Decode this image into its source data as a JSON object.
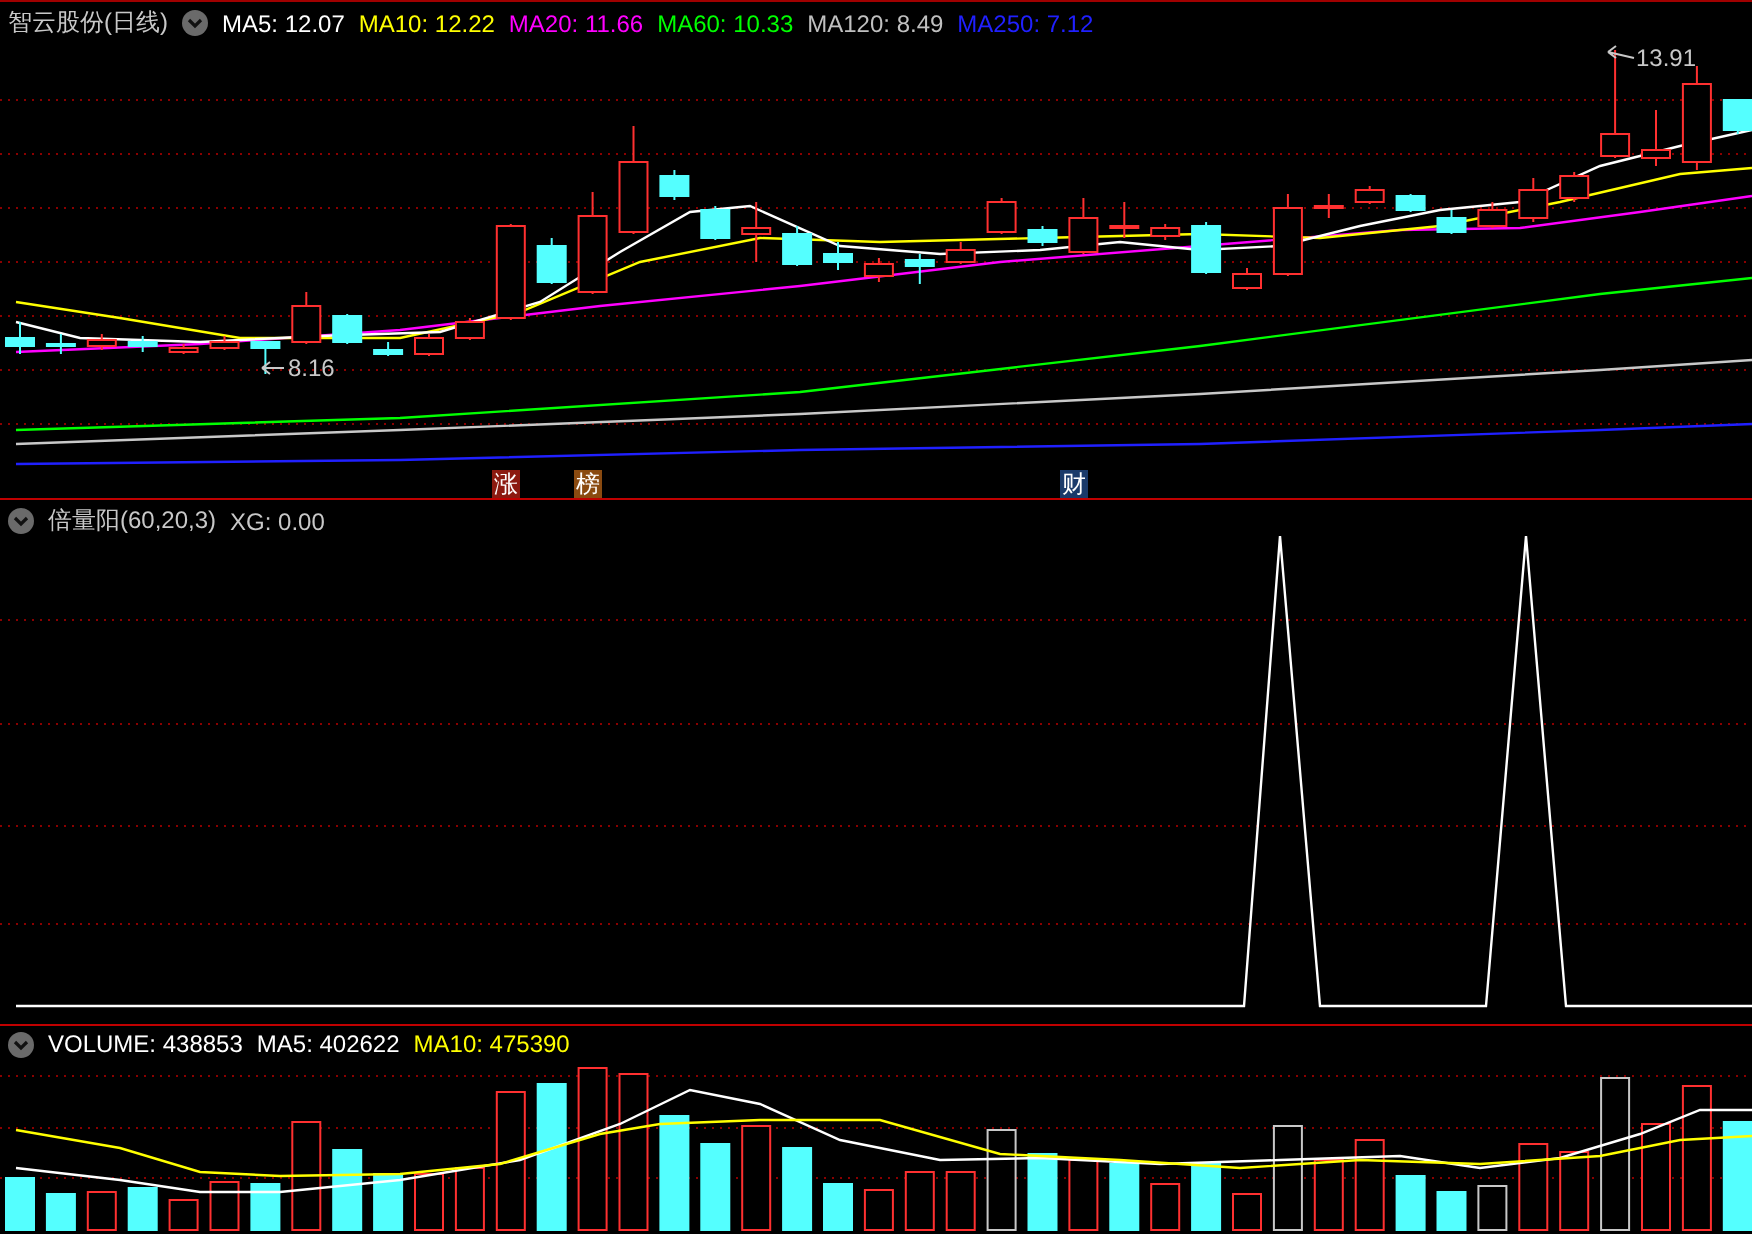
{
  "main_panel": {
    "title": "智云股份(日线)",
    "legend": [
      {
        "text": "MA5: 12.07",
        "color": "#ffffff"
      },
      {
        "text": "MA10: 12.22",
        "color": "#ffff00"
      },
      {
        "text": "MA20: 11.66",
        "color": "#ff00ff"
      },
      {
        "text": "MA60: 10.33",
        "color": "#00ff00"
      },
      {
        "text": "MA120: 8.49",
        "color": "#c0c0c0"
      },
      {
        "text": "MA250: 7.12",
        "color": "#2020ff"
      }
    ],
    "high_label": "13.91",
    "low_label": "8.16",
    "event_markers": [
      {
        "text": "涨",
        "color": "#8c1a10"
      },
      {
        "text": "榜",
        "color": "#8a4a10"
      },
      {
        "text": "财",
        "color": "#1a3a6a"
      }
    ]
  },
  "signal_panel": {
    "title": "倍量阳(60,20,3)",
    "readout": "XG: 0.00"
  },
  "volume_panel": {
    "legend": [
      {
        "text": "VOLUME: 438853",
        "color": "#ffffff"
      },
      {
        "text": "MA5: 402622",
        "color": "#ffffff"
      },
      {
        "text": "MA10: 475390",
        "color": "#ffff00"
      }
    ]
  }
}
